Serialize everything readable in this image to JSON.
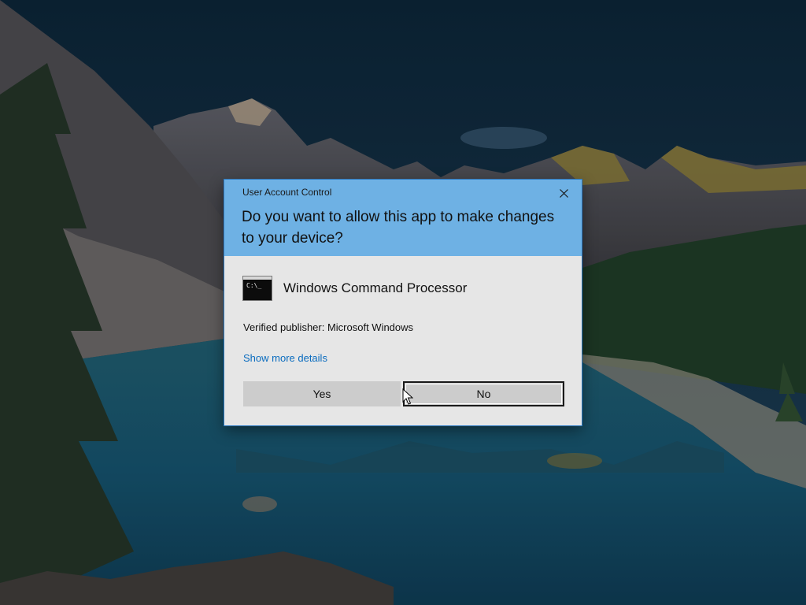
{
  "dialog": {
    "caption": "User Account Control",
    "question": "Do you want to allow this app to make changes to your device?",
    "app_name": "Windows Command Processor",
    "app_icon": "command-prompt-icon",
    "app_icon_text": "C:\\_",
    "publisher": "Verified publisher: Microsoft Windows",
    "details_link": "Show more details",
    "yes_label": "Yes",
    "no_label": "No",
    "focused_button": "No",
    "close_icon": "close-icon"
  },
  "colors": {
    "header_blue": "#6eb1e4",
    "dialog_body": "#e6e6e6",
    "link_blue": "#0a6cbf",
    "button_gray": "#cccccc"
  },
  "background": {
    "description_icon": "desktop-wallpaper-mountain-lake"
  }
}
